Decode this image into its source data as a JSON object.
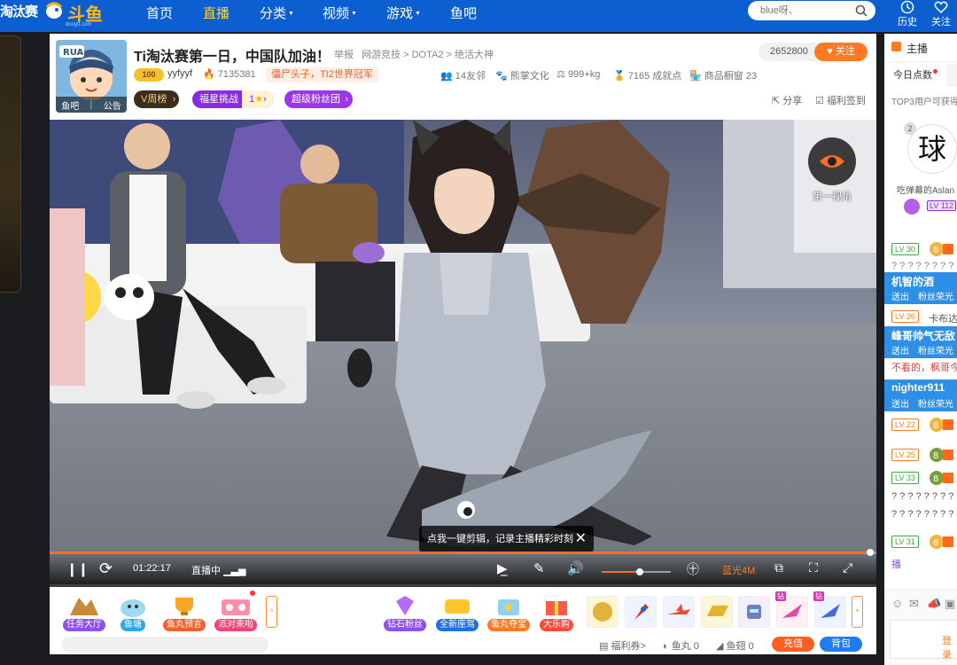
{
  "nav": {
    "event_logo": "淘汰赛",
    "brand": "斗鱼",
    "brand_sub": "douyu.com",
    "links": [
      "首页",
      "直播",
      "分类",
      "视频",
      "游戏",
      "鱼吧"
    ],
    "active": "直播",
    "search_placeholder": "blue呀、",
    "history": "历史",
    "follow": "关注"
  },
  "room": {
    "avatar_tabs": [
      "鱼吧",
      "公告"
    ],
    "title": "Ti淘汰赛第一日，中国队加油！",
    "tags": [
      "举报",
      "网游竞技 > DOTA2 > 绝活大神"
    ],
    "follower_count": "2652800",
    "follow_button": "关注",
    "anchor_level": "100",
    "anchor_name": "yyfyyf",
    "hot": "7135381",
    "honor": "僵尸头子，TI2世界冠军",
    "friends": "14友邻",
    "company": "熊掌文化",
    "weight": "999+kg",
    "achievements": "7165 成就点",
    "showcase": "商品橱窗 23",
    "badges": {
      "weekly": "V周榜",
      "lucky_star": "福星挑战",
      "lucky_count": "1",
      "super_fans": "超级粉丝团"
    },
    "share": "分享",
    "checkin": "福利签到"
  },
  "player": {
    "first_view": "第一视角",
    "clip_tip": "点我一键剪辑，记录主播精彩时刻",
    "time": "01:22:17",
    "status": "直播中",
    "quality": "蓝光4M",
    "progress_fraction": 0.993,
    "volume_fraction": 0.55
  },
  "gifts": {
    "left": [
      {
        "label": "任务大厅",
        "color": "#8d4ff2"
      },
      {
        "label": "鱼塘",
        "color": "#2fa7ee"
      },
      {
        "label": "鱼丸预言",
        "color": "#f4612b"
      },
      {
        "label": "派对来啦",
        "color": "#f04576"
      }
    ],
    "right": [
      {
        "label": "钻石粉丝",
        "color": "#8d4ff2"
      },
      {
        "label": "全新座驾",
        "color": "#1f6fe6"
      },
      {
        "label": "鱼丸夺宝",
        "color": "#ff7a22"
      },
      {
        "label": "大乐购",
        "color": "#ff4a3a"
      }
    ],
    "item_icons": [
      "gold-lion-icon",
      "rocket-icon",
      "plane-icon",
      "gold-bar-icon",
      "robot-icon",
      "pink-jet-icon",
      "blue-jet-icon"
    ],
    "footer": {
      "coupon": "福利券>",
      "fishball": "鱼丸 0",
      "fin": "鱼翅 0",
      "recharge": "充值",
      "bag": "背包"
    }
  },
  "sidebar": {
    "header": "主播",
    "tab": "今日点数",
    "top3": "TOP3用户可获得",
    "rank_user": "吃弹幕的Aslan",
    "rank_pos": "2",
    "rank_level": "LV 112",
    "rank_char": "球",
    "chat": [
      {
        "type": "row",
        "level": "LV 30",
        "color": "#3aae3a",
        "medal": "8"
      },
      {
        "type": "text",
        "text": "? ? ? ? ? ? ? ?",
        "color": "#888"
      },
      {
        "type": "notice",
        "name": "机智的酒",
        "sub": "送出　粉丝荣光"
      },
      {
        "type": "row",
        "level": "LV 26",
        "color": "#ff7a22",
        "medal": "",
        "text": "卡布达"
      },
      {
        "type": "notice",
        "name": "峰哥帅气无敌",
        "sub": "送出　粉丝荣光"
      },
      {
        "type": "text",
        "text": "不看的，枫哥今",
        "color": "#e53935"
      },
      {
        "type": "notice",
        "name": "nighter911",
        "sub": "送出　粉丝荣光"
      },
      {
        "type": "row",
        "level": "LV 22",
        "color": "#ff7a22",
        "medal": "8"
      },
      {
        "type": "row",
        "level": "LV 25",
        "color": "#ff7a22",
        "medal": "8"
      },
      {
        "type": "row",
        "level": "LV 33",
        "color": "#3aae3a",
        "medal": "8"
      },
      {
        "type": "text",
        "text": "? ? ? ? ? ? ? ?",
        "color": "#555"
      },
      {
        "type": "text",
        "text": "? ? ? ? ? ? ? ?",
        "color": "#555"
      },
      {
        "type": "row",
        "level": "LV 31",
        "color": "#3aae3a",
        "medal": "8"
      },
      {
        "type": "text",
        "text": "播",
        "color": "#7a4dd8"
      }
    ],
    "login": "登录"
  }
}
